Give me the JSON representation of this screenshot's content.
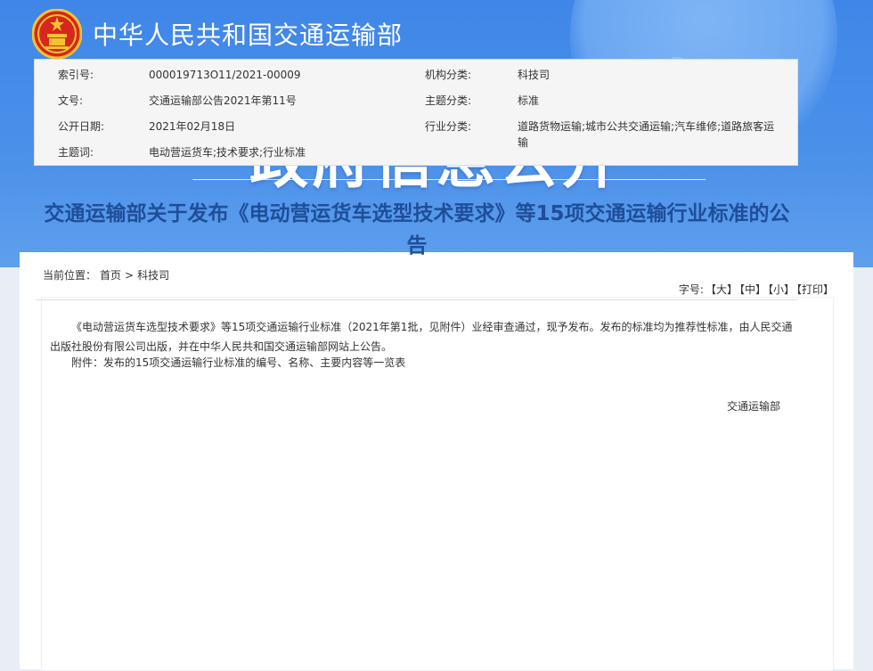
{
  "header": {
    "ministry_name": "中华人民共和国交通运输部",
    "section_title": "政府信息公开"
  },
  "breadcrumb": {
    "label": "当前位置：",
    "home": "首页",
    "separator": ">",
    "current": "科技司"
  },
  "meta": {
    "index_label": "索引号:",
    "index_value": "000019713O11/2021-00009",
    "org_label": "机构分类:",
    "org_value": "科技司",
    "doc_no_label": "文号:",
    "doc_no_value": "交通运输部公告2021年第11号",
    "topic_label": "主题分类:",
    "topic_value": "标准",
    "date_label": "公开日期:",
    "date_value": "2021年02月18日",
    "industry_label": "行业分类:",
    "industry_value": "道路货物运输;城市公共交通运输;汽车维修;道路旅客运输",
    "keywords_label": "主题词:",
    "keywords_value": "电动营运货车;技术要求;行业标准"
  },
  "doc": {
    "title": "交通运输部关于发布《电动营运货车选型技术要求》等15项交通运输行业标准的公告",
    "font_label": "字号:",
    "font_large": "【大】",
    "font_medium": "【中】",
    "font_small": "【小】",
    "print": "【打印】",
    "para1": "《电动营运货车选型技术要求》等15项交通运输行业标准（2021年第1批，见附件）业经审查通过，现予发布。发布的标准均为推荐性标准，由人民交通出版社股份有限公司出版，并在中华人民共和国交通运输部网站上公告。",
    "para2": "附件：发布的15项交通运输行业标准的编号、名称、主要内容等一览表",
    "signature": "交通运输部"
  },
  "colors": {
    "banner": "#4a90ea",
    "title_blue": "#1f4e99",
    "emblem_red": "#d7261e",
    "emblem_gold": "#f4c430"
  }
}
